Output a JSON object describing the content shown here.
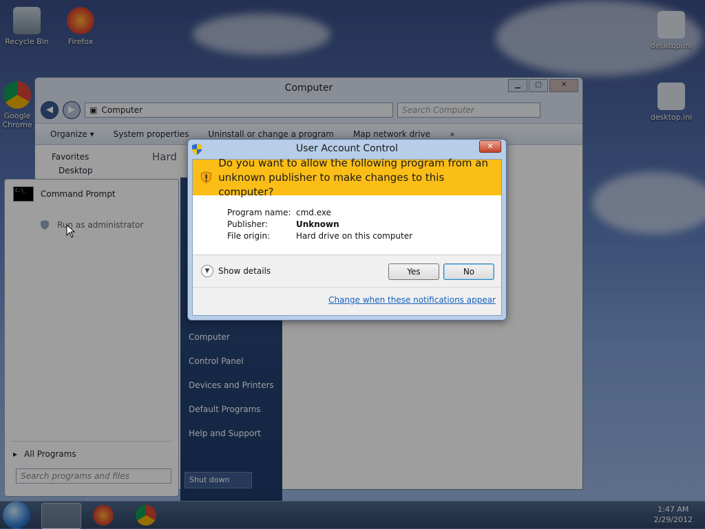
{
  "desktop": {
    "icons": [
      "Recycle Bin",
      "Firefox",
      "Google Chrome",
      "desktop.ini",
      "desktop.ini"
    ]
  },
  "explorer": {
    "title": "Computer",
    "address": "Computer",
    "search_placeholder": "Search Computer",
    "toolbar": [
      "Organize ▾",
      "System properties",
      "Uninstall or change a program",
      "Map network drive",
      "»"
    ],
    "nav": [
      "Favorites",
      "Desktop"
    ],
    "section_hint": "Hard"
  },
  "start_menu": {
    "pinned_item": "Command Prompt",
    "context_item": "Run as administrator",
    "all_programs": "All Programs",
    "search_placeholder": "Search programs and files",
    "right_items": [
      "Computer",
      "Control Panel",
      "Devices and Printers",
      "Default Programs",
      "Help and Support"
    ],
    "shutdown_label": "Shut down"
  },
  "uac": {
    "title": "User Account Control",
    "question": "Do you want to allow the following program from an unknown publisher to make changes to this computer?",
    "program_label": "Program name:",
    "program_value": "cmd.exe",
    "publisher_label": "Publisher:",
    "publisher_value": "Unknown",
    "origin_label": "File origin:",
    "origin_value": "Hard drive on this computer",
    "show_details": "Show details",
    "yes_label": "Yes",
    "no_label": "No",
    "link": "Change when these notifications appear",
    "close_label": "✕"
  },
  "taskbar": {
    "time": "1:47 AM",
    "date": "2/29/2012"
  },
  "colors": {
    "banner": "#fbbe16",
    "link": "#1560bd"
  }
}
